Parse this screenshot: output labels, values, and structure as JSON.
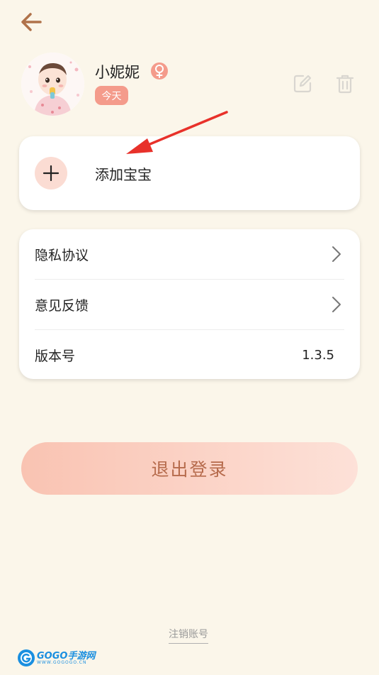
{
  "profile": {
    "name": "小妮妮",
    "age_badge": "今天",
    "gender": "female"
  },
  "add_baby": {
    "label": "添加宝宝"
  },
  "menu": {
    "privacy": "隐私协议",
    "feedback": "意见反馈",
    "version_label": "版本号",
    "version_value": "1.3.5"
  },
  "logout": {
    "label": "退出登录"
  },
  "cancel_account": {
    "label": "注销账号"
  },
  "watermark": {
    "main": "GOGO手游网",
    "sub": "WWW.GOGOGO.CN"
  },
  "colors": {
    "background": "#fbf6ea",
    "accent": "#f49b8b",
    "logout_text": "#b66b4c",
    "back_arrow": "#b0724a",
    "annotation_arrow": "#e8312a"
  }
}
